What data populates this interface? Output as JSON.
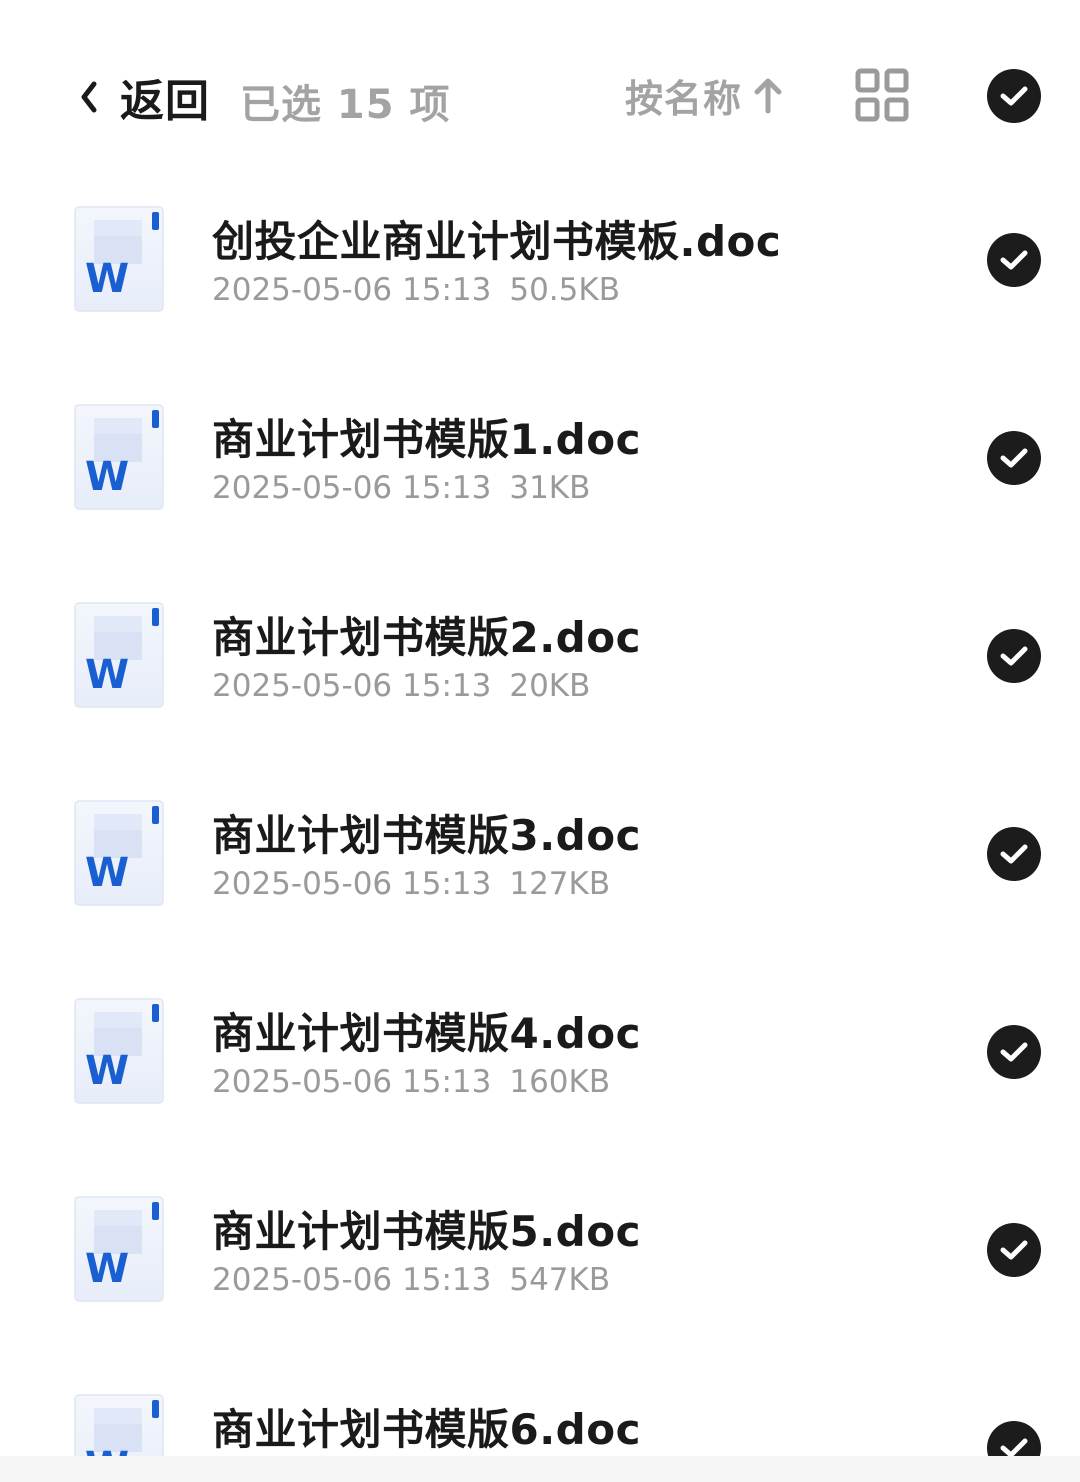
{
  "header": {
    "back_label": "返回",
    "selected_text": "已选 15 项",
    "sort_label": "按名称"
  },
  "colors": {
    "check_bg": "#1c1c1c",
    "word_blue": "#1a5fd1",
    "text_primary": "#1a1a1a",
    "text_secondary": "#9a9a9a"
  },
  "files": [
    {
      "name": "创投企业商业计划书模板.doc",
      "date": "2025-05-06 15:13",
      "size": "50.5KB",
      "icon": "word-doc-icon"
    },
    {
      "name": "商业计划书模版1.doc",
      "date": "2025-05-06 15:13",
      "size": "31KB",
      "icon": "word-doc-icon"
    },
    {
      "name": "商业计划书模版2.doc",
      "date": "2025-05-06 15:13",
      "size": "20KB",
      "icon": "word-doc-icon"
    },
    {
      "name": "商业计划书模版3.doc",
      "date": "2025-05-06 15:13",
      "size": "127KB",
      "icon": "word-doc-icon"
    },
    {
      "name": "商业计划书模版4.doc",
      "date": "2025-05-06 15:13",
      "size": "160KB",
      "icon": "word-doc-icon"
    },
    {
      "name": "商业计划书模版5.doc",
      "date": "2025-05-06 15:13",
      "size": "547KB",
      "icon": "word-doc-icon"
    },
    {
      "name": "商业计划书模版6.doc",
      "date": "",
      "size": "",
      "icon": "word-doc-icon"
    }
  ]
}
